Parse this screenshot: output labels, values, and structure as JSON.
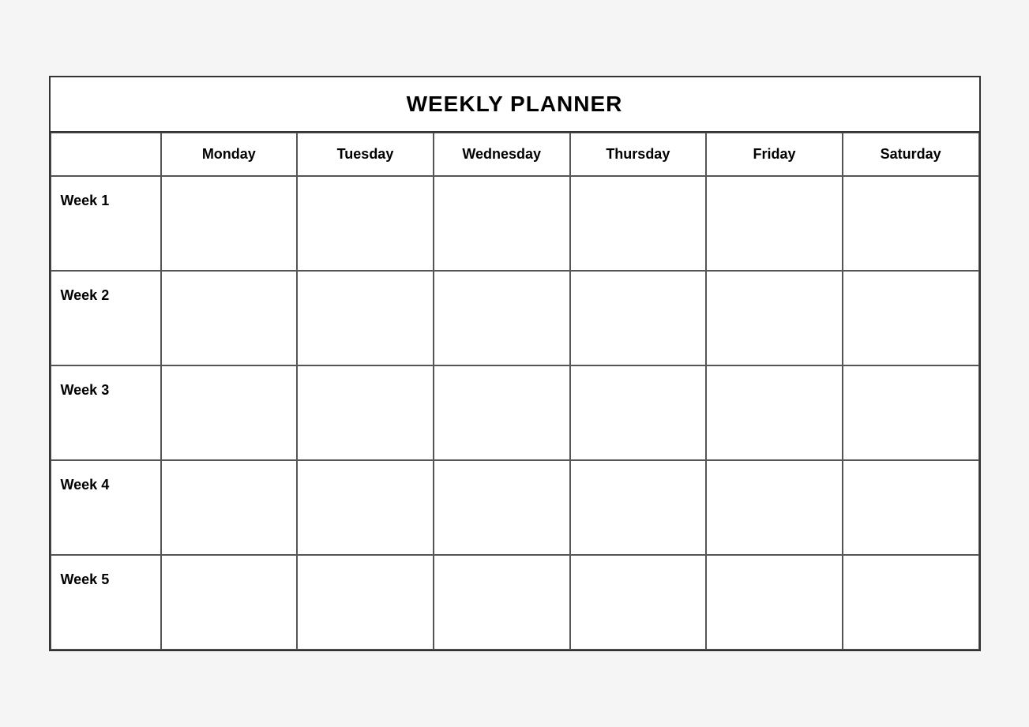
{
  "title": "WEEKLY PLANNER",
  "days": [
    "Monday",
    "Tuesday",
    "Wednesday",
    "Thursday",
    "Friday",
    "Saturday"
  ],
  "weeks": [
    "Week 1",
    "Week 2",
    "Week 3",
    "Week 4",
    "Week 5"
  ]
}
